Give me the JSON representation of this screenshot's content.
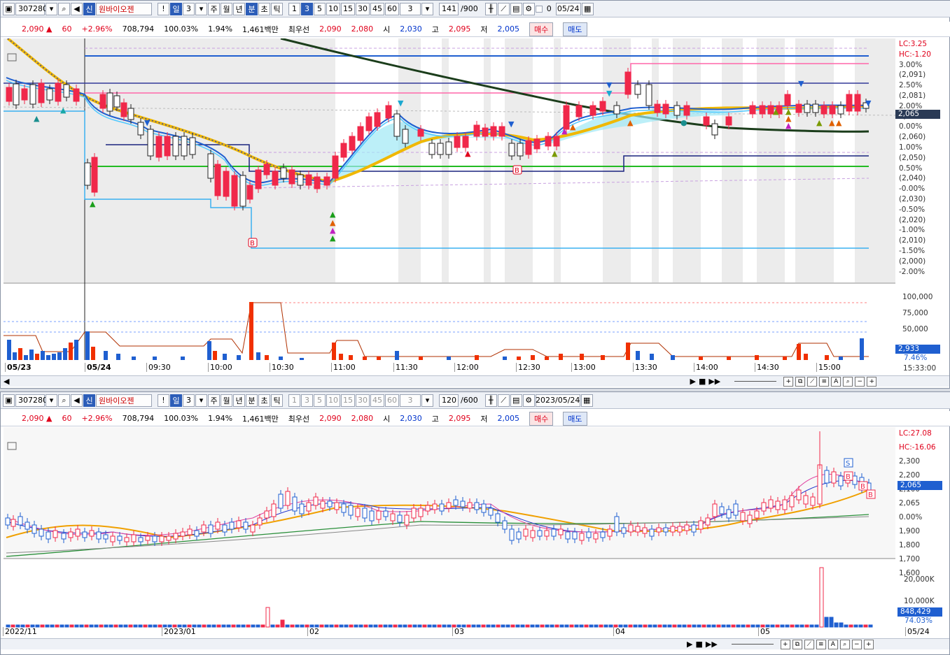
{
  "top": {
    "code": "307280",
    "name": "원바이오젠",
    "sin": "신",
    "warn": "!",
    "period_sel": "일",
    "count": "3",
    "periods": [
      "주",
      "월",
      "년",
      "분",
      "초",
      "틱"
    ],
    "intervals": [
      "1",
      "3",
      "5",
      "10",
      "15",
      "30",
      "45",
      "60"
    ],
    "interval_count": "3",
    "bars": "141",
    "bars_total": "/900",
    "check_val": "0",
    "date": "05/24"
  },
  "bottom": {
    "code": "307280",
    "name": "원바이오젠",
    "sin": "신",
    "warn": "!",
    "period_sel": "일",
    "count": "3",
    "periods": [
      "주",
      "월",
      "년",
      "분",
      "초",
      "틱"
    ],
    "intervals": [
      "1",
      "3",
      "5",
      "10",
      "15",
      "30",
      "45",
      "60"
    ],
    "interval_count": "3",
    "bars": "120",
    "bars_total": "/600",
    "date": "2023/05/24"
  },
  "quote": {
    "price": "2,090",
    "arrow": "▲",
    "change": "60",
    "pct": "+2.96%",
    "volume": "708,794",
    "vol_ratio": "100.03%",
    "turnover": "1.94%",
    "amount": "1,461백만",
    "best_label": "최우선",
    "ask": "2,090",
    "bid": "2,080",
    "open_label": "시",
    "open": "2,030",
    "high_label": "고",
    "high": "2,095",
    "low_label": "저",
    "low": "2,005",
    "buy": "매수",
    "sell": "매도"
  },
  "intraday": {
    "right_axis": [
      "LC:3.25",
      "HC:-1.20",
      "3.00%",
      "(2,091)",
      "2.50%",
      "(2,081)",
      "2.00%",
      "2,065",
      "0.00%",
      "(2,060)",
      "1.00%",
      "(2,050)",
      "0.50%",
      "(2,040)",
      "-0.00%",
      "(2,030)",
      "-0.50%",
      "(2,020)",
      "-1.00%",
      "(2,010)",
      "-1.50%",
      "(2,000)",
      "-2.00%"
    ],
    "price_tag": "2,065",
    "vol_axis": [
      "100,000",
      "75,000",
      "50,000"
    ],
    "vol_tag": "2,933",
    "vol_pct": "7.46%",
    "time_labels": [
      "05/23",
      "05/24",
      "09:30",
      "10:00",
      "10:30",
      "11:00",
      "11:30",
      "12:00",
      "12:30",
      "13:00",
      "13:30",
      "14:00",
      "14:30",
      "15:00"
    ],
    "clock": "15:33:00"
  },
  "daily": {
    "right_axis": [
      "LC:27.08",
      "HC:-16.06",
      "2,300",
      "2,200",
      "2,100",
      "2,065",
      "0.00%",
      "1,900",
      "1,800",
      "1,700",
      "1,600"
    ],
    "price_tag": "2,065",
    "vol_axis": [
      "20,000K",
      "10,000K"
    ],
    "vol_tag": "848,429",
    "vol_pct": "74.03%",
    "date_labels": [
      "2022/11",
      "2023/01",
      "02",
      "03",
      "04",
      "05",
      "05/24"
    ]
  },
  "colors": {
    "up": "#f0284a",
    "down": "#1f5fd0",
    "accent": "#2c5db8"
  }
}
